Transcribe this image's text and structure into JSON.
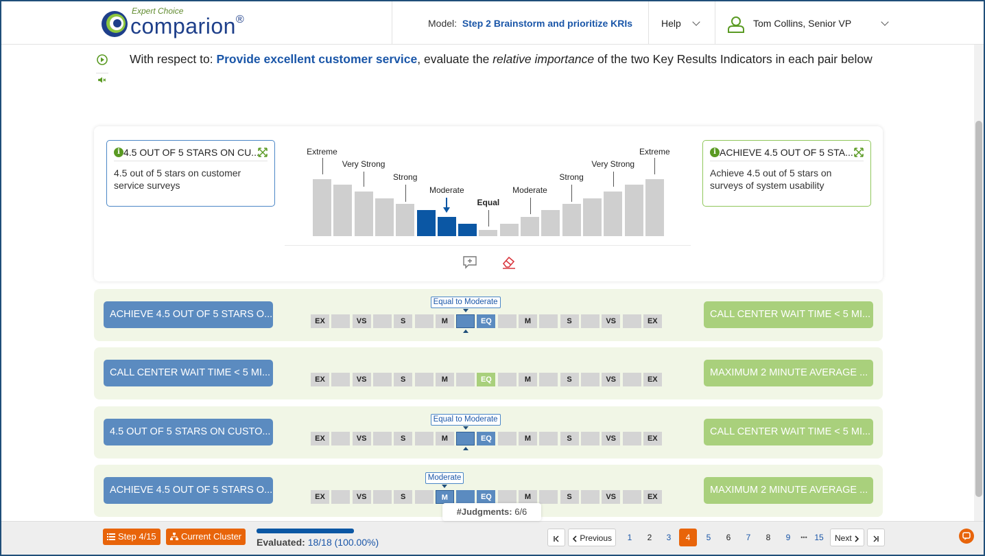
{
  "header": {
    "logo_small": "Expert Choice",
    "logo_main": "comparion",
    "logo_reg": "®",
    "model_label": "Model:",
    "model_name": "Step 2 Brainstorm and prioritize KRIs",
    "help_label": "Help",
    "user_name": "Tom Collins, Senior VP"
  },
  "prompt": {
    "prefix": "With respect to:",
    "objective": "Provide excellent customer service",
    "middle": ", evaluate the",
    "emphasis": "relative importance",
    "suffix": "of the two Key Results Indicators in each pair below"
  },
  "main_comparison": {
    "left_title": "4.5 OUT OF 5 STARS ON CU...",
    "left_desc": "4.5 out of 5 stars on customer service surveys",
    "right_title": "ACHIEVE 4.5 OUT OF 5 STA...",
    "right_desc": "Achieve 4.5 out of 5 stars on surveys of system usability",
    "scale_labels": {
      "extreme_left": "Extreme",
      "very_strong_left": "Very Strong",
      "strong_left": "Strong",
      "moderate_left": "Moderate",
      "equal": "Equal",
      "moderate_right": "Moderate",
      "strong_right": "Strong",
      "very_strong_right": "Very Strong",
      "extreme_right": "Extreme"
    },
    "selected_level": "Moderate",
    "selected_side": "left"
  },
  "scale_cells": [
    "EX",
    "",
    "VS",
    "",
    "S",
    "",
    "M",
    "",
    "EQ",
    "",
    "M",
    "",
    "S",
    "",
    "VS",
    "",
    "EX"
  ],
  "pairs": [
    {
      "left": "ACHIEVE 4.5 OUT OF 5 STARS O...",
      "right": "CALL CENTER WAIT TIME < 5 MI...",
      "tooltip": "Equal to Moderate",
      "selected_index": 7,
      "blue_cells": [
        8
      ]
    },
    {
      "left": "CALL CENTER WAIT TIME < 5 MI...",
      "right": "MAXIMUM 2 MINUTE AVERAGE ...",
      "tooltip": "",
      "selected_index": null,
      "green_cells": [
        8
      ]
    },
    {
      "left": "4.5 OUT OF 5 STARS ON CUSTO...",
      "right": "CALL CENTER WAIT TIME < 5 MI...",
      "tooltip": "Equal to Moderate",
      "selected_index": 7,
      "blue_cells": [
        8
      ]
    },
    {
      "left": "ACHIEVE 4.5 OUT OF 5 STARS O...",
      "right": "MAXIMUM 2 MINUTE AVERAGE ...",
      "tooltip": "Moderate",
      "selected_index": 6,
      "blue_cells": [
        7,
        8
      ]
    }
  ],
  "judgments": {
    "label": "#Judgments:",
    "value": "6/6"
  },
  "footer": {
    "step_label": "Step 4/15",
    "cluster_label": "Current Cluster",
    "evaluated_label": "Evaluated:",
    "evaluated_value": "18/18 (100.00%)",
    "progress": 1.0,
    "previous_label": "Previous",
    "next_label": "Next",
    "pages": [
      "1",
      "2",
      "3",
      "4",
      "5",
      "6",
      "7",
      "8",
      "9"
    ],
    "ellipsis": "•••",
    "last_page": "15",
    "current_page": "4"
  },
  "colors": {
    "brand_blue": "#1a56a8",
    "selected_bar": "#0b57a4",
    "orange": "#e8640a",
    "left_pill": "#5b8bc0",
    "right_pill": "#a9d07c"
  }
}
